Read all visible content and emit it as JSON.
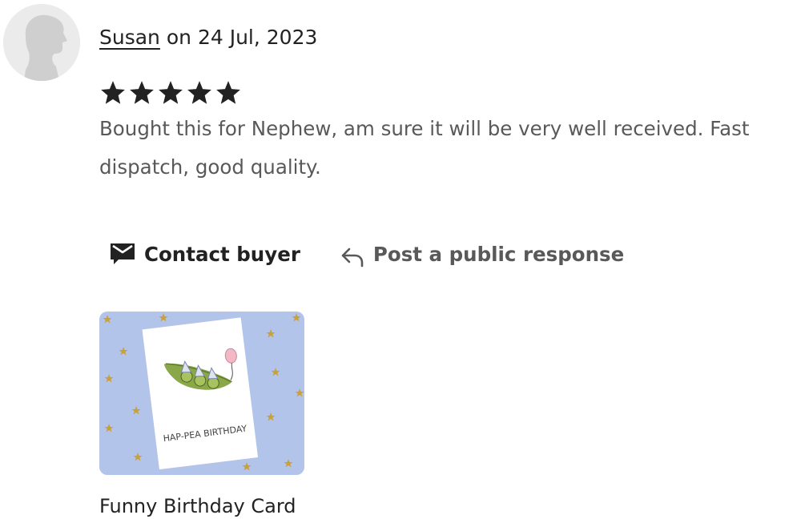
{
  "review": {
    "reviewer_name": "Susan",
    "date_prefix": " on ",
    "date": "24 Jul, 2023",
    "rating": 5,
    "rating_max": 5,
    "text": "Bought this for Nephew, am sure it will be very well received. Fast dispatch, good quality."
  },
  "actions": {
    "contact_buyer": "Contact buyer",
    "public_response": "Post a public response"
  },
  "product": {
    "title": "Funny Birthday Card",
    "card_text": "HAP-PEA BIRTHDAY"
  },
  "colors": {
    "text_primary": "#222222",
    "text_secondary": "#595959",
    "avatar_bg": "#ebebeb",
    "thumb_bg": "#b3c4ea",
    "star_gold": "#c9a13c"
  },
  "icons": {
    "avatar": "default-user-silhouette-icon",
    "star": "star-filled-icon",
    "contact": "envelope-message-icon",
    "response": "reply-arrow-icon"
  }
}
